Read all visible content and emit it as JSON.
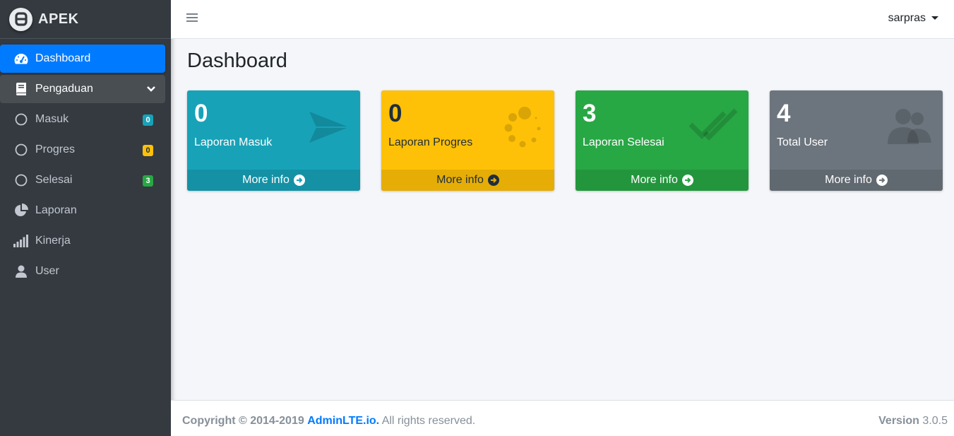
{
  "brand": {
    "name": "APEK"
  },
  "sidebar": {
    "items": [
      {
        "label": "Dashboard",
        "icon": "tachometer-icon"
      },
      {
        "label": "Pengaduan",
        "icon": "book-icon"
      },
      {
        "label": "Masuk",
        "icon": "circle-icon",
        "badge": "0"
      },
      {
        "label": "Progres",
        "icon": "circle-icon",
        "badge": "0"
      },
      {
        "label": "Selesai",
        "icon": "circle-icon",
        "badge": "3"
      },
      {
        "label": "Laporan",
        "icon": "pie-chart-icon"
      },
      {
        "label": "Kinerja",
        "icon": "signal-icon"
      },
      {
        "label": "User",
        "icon": "user-icon"
      }
    ]
  },
  "header": {
    "user": "sarpras"
  },
  "page": {
    "title": "Dashboard"
  },
  "boxes": [
    {
      "value": "0",
      "label": "Laporan Masuk",
      "more": "More info",
      "color": "#17a2b8",
      "icon": "paper-plane-icon"
    },
    {
      "value": "0",
      "label": "Laporan Progres",
      "more": "More info",
      "color": "#ffc107",
      "icon": "spinner-icon"
    },
    {
      "value": "3",
      "label": "Laporan Selesai",
      "more": "More info",
      "color": "#28a745",
      "icon": "check-double-icon"
    },
    {
      "value": "4",
      "label": "Total User",
      "more": "More info",
      "color": "#6c757d",
      "icon": "users-icon"
    }
  ],
  "footer": {
    "copyright": "Copyright © 2014-2019",
    "link": "AdminLTE.io.",
    "rights": "All rights reserved.",
    "version_label": "Version",
    "version": "3.0.5"
  }
}
